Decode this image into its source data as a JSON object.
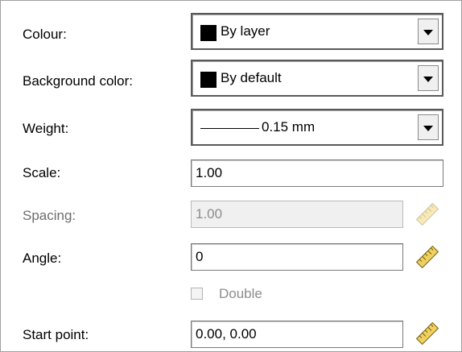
{
  "fields": {
    "colour": {
      "label": "Colour:",
      "value": "By layer",
      "swatch_color": "#000000"
    },
    "background_color": {
      "label": "Background color:",
      "value": "By default",
      "swatch_color": "#000000"
    },
    "weight": {
      "label": "Weight:",
      "value": "0.15 mm"
    },
    "scale": {
      "label": "Scale:",
      "value": "1.00"
    },
    "spacing": {
      "label": "Spacing:",
      "value": "1.00",
      "disabled": true
    },
    "angle": {
      "label": "Angle:",
      "value": "0"
    },
    "double": {
      "label": "Double",
      "checked": false,
      "disabled": true
    },
    "start_point": {
      "label": "Start point:",
      "value": "0.00, 0.00"
    }
  },
  "icons": {
    "pick": "ruler-pick-icon"
  },
  "colors": {
    "disabled_text": "#8d8d8d",
    "ruler_fill": "#f0d060",
    "ruler_fill_disabled": "#f3e4a8"
  }
}
